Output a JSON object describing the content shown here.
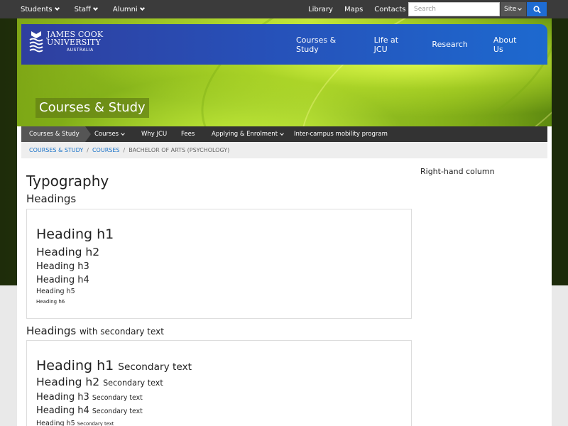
{
  "topbar": {
    "left_items": [
      "Students",
      "Staff",
      "Alumni"
    ],
    "right_links": [
      "Library",
      "Maps",
      "Contacts"
    ],
    "search_placeholder": "Search",
    "site_select": "Site"
  },
  "logo": {
    "line1": "JAMES COOK",
    "line2": "UNIVERSITY",
    "line3": "AUSTRALIA"
  },
  "main_nav": [
    "Courses & Study",
    "Life at JCU",
    "Research",
    "About Us"
  ],
  "hero_title": "Courses & Study",
  "sub_nav": {
    "active": "Courses & Study",
    "items": [
      "Courses",
      "Why JCU",
      "Fees",
      "Applying & Enrolment",
      "Inter-campus mobility program"
    ]
  },
  "breadcrumb": {
    "link1": "COURSES & STUDY",
    "link2": "COURSES",
    "current": "BACHELOR OF ARTS (PSYCHOLOGY)",
    "separator": "/"
  },
  "content": {
    "title": "Typography",
    "section1_title": "Headings",
    "section2_title": "Headings",
    "section2_sub": "with secondary text",
    "headings": [
      "Heading h1",
      "Heading h2",
      "Heading h3",
      "Heading h4",
      "Heading h5",
      "Heading h6"
    ],
    "secondary_text": "Secondary text"
  },
  "right_column": "Right-hand column",
  "colors": {
    "topbar": "#3b3b3b",
    "nav_start": "#2f3f9f",
    "nav_end": "#1d69cf",
    "link": "#1a73c9",
    "search_button": "#1e6cd3"
  }
}
